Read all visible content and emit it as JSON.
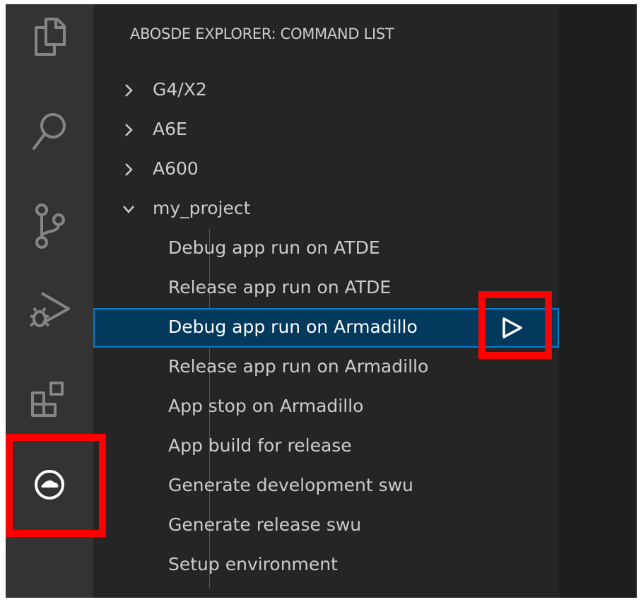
{
  "sidebar": {
    "title": "ABOSDE EXPLORER: COMMAND LIST",
    "folders": [
      {
        "label": "G4/X2",
        "expanded": false
      },
      {
        "label": "A6E",
        "expanded": false
      },
      {
        "label": "A600",
        "expanded": false
      },
      {
        "label": "my_project",
        "expanded": true
      }
    ],
    "commands": [
      {
        "label": "Debug app run on ATDE"
      },
      {
        "label": "Release app run on ATDE"
      },
      {
        "label": "Debug app run on Armadillo",
        "selected": true
      },
      {
        "label": "Release app run on Armadillo"
      },
      {
        "label": "App stop on Armadillo"
      },
      {
        "label": "App build for release"
      },
      {
        "label": "Generate development swu"
      },
      {
        "label": "Generate release swu"
      },
      {
        "label": "Setup environment"
      }
    ]
  },
  "activity_bar": {
    "icons": [
      "explorer-icon",
      "search-icon",
      "source-control-icon",
      "run-debug-icon",
      "extensions-icon",
      "abosde-icon"
    ],
    "active": "abosde-icon"
  },
  "colors": {
    "activity_bar": "#333333",
    "sidebar": "#252526",
    "editor": "#1e1e1e",
    "selection": "#04395e",
    "selection_border": "#007fd4",
    "highlight": "#ff0000",
    "text": "#cccccc"
  }
}
